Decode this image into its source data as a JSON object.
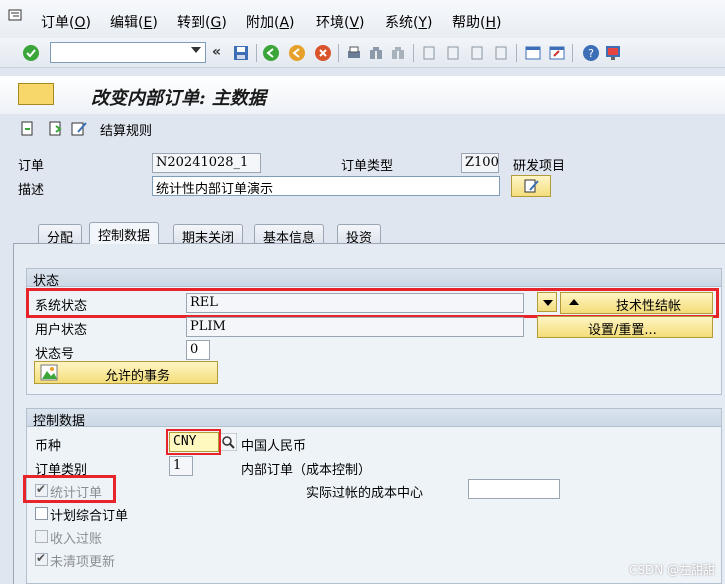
{
  "menu": [
    "订单(O)",
    "编辑(E)",
    "转到(G)",
    "附加(A)",
    "环境(V)",
    "系统(Y)",
    "帮助(H)"
  ],
  "menu_parts": [
    {
      "text": "订单(",
      "key": "O",
      "tail": ")"
    },
    {
      "text": "编辑(",
      "key": "E",
      "tail": ")"
    },
    {
      "text": "转到(",
      "key": "G",
      "tail": ")"
    },
    {
      "text": "附加(",
      "key": "A",
      "tail": ")"
    },
    {
      "text": "环境(",
      "key": "V",
      "tail": ")"
    },
    {
      "text": "系统(",
      "key": "Y",
      "tail": ")"
    },
    {
      "text": "帮助(",
      "key": "H",
      "tail": ")"
    }
  ],
  "toolbar": {
    "command_value": "",
    "collapse_symbol": "«"
  },
  "title": "改变内部订单: 主数据",
  "app_toolbar": {
    "settlement_rule": "结算规则"
  },
  "header": {
    "order_label": "订单",
    "order_value": "N20241028_1",
    "order_type_label": "订单类型",
    "order_type_value": "Z100",
    "order_type_text": "研发项目",
    "desc_label": "描述",
    "desc_value": "统计性内部订单演示"
  },
  "tabs": [
    "分配",
    "控制数据",
    "期末关闭",
    "基本信息",
    "投资"
  ],
  "active_tab": 1,
  "status_group": {
    "title": "状态",
    "system_status_label": "系统状态",
    "system_status_value": "REL",
    "user_status_label": "用户状态",
    "user_status_value": "PLIM",
    "status_no_label": "状态号",
    "status_no_value": "0",
    "allowed_txn_button": "允许的事务",
    "tech_complete_button": "技术性结帐",
    "set_reset_button": "设置/重置..."
  },
  "control_group": {
    "title": "控制数据",
    "currency_label": "币种",
    "currency_value": "CNY",
    "currency_text": "中国人民币",
    "order_category_label": "订单类别",
    "order_category_value": "1",
    "order_category_text": "内部订单（成本控制）",
    "actual_cc_label": "实际过帐的成本中心",
    "actual_cc_value": "",
    "checkboxes": [
      {
        "label": "统计订单",
        "checked": true,
        "disabled": true
      },
      {
        "label": "计划综合订单",
        "checked": false,
        "disabled": false
      },
      {
        "label": "收入过账",
        "checked": false,
        "disabled": true
      },
      {
        "label": "未清项更新",
        "checked": true,
        "disabled": true
      }
    ]
  },
  "watermark": "CSDN @左甜甜",
  "colors": {
    "highlight": "#e8242b",
    "button": "#f3dd79"
  }
}
